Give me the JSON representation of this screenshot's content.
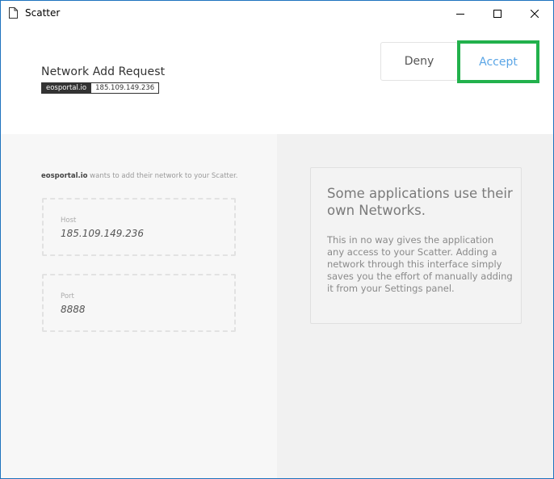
{
  "window": {
    "title": "Scatter",
    "icon": "document-icon",
    "controls": [
      "minimize-icon",
      "maximize-icon",
      "close-icon"
    ]
  },
  "header": {
    "title": "Network Add Request",
    "origin": "eosportal.io",
    "ip": "185.109.149.236",
    "deny_label": "Deny",
    "accept_label": "Accept"
  },
  "request": {
    "origin": "eosportal.io",
    "intro_text": " wants to add their network to your Scatter.",
    "fields": [
      {
        "label": "Host",
        "value": "185.109.149.236"
      },
      {
        "label": "Port",
        "value": "8888"
      }
    ]
  },
  "info": {
    "heading": "Some applications use their own Networks.",
    "body": "This in no way gives the application any access to your Scatter. Adding a network through this interface simply saves you the effort of manually adding it from your Settings panel."
  },
  "colors": {
    "accent_blue": "#5aa5e6",
    "highlight_green": "#22b14c",
    "window_border": "#1e73be"
  }
}
